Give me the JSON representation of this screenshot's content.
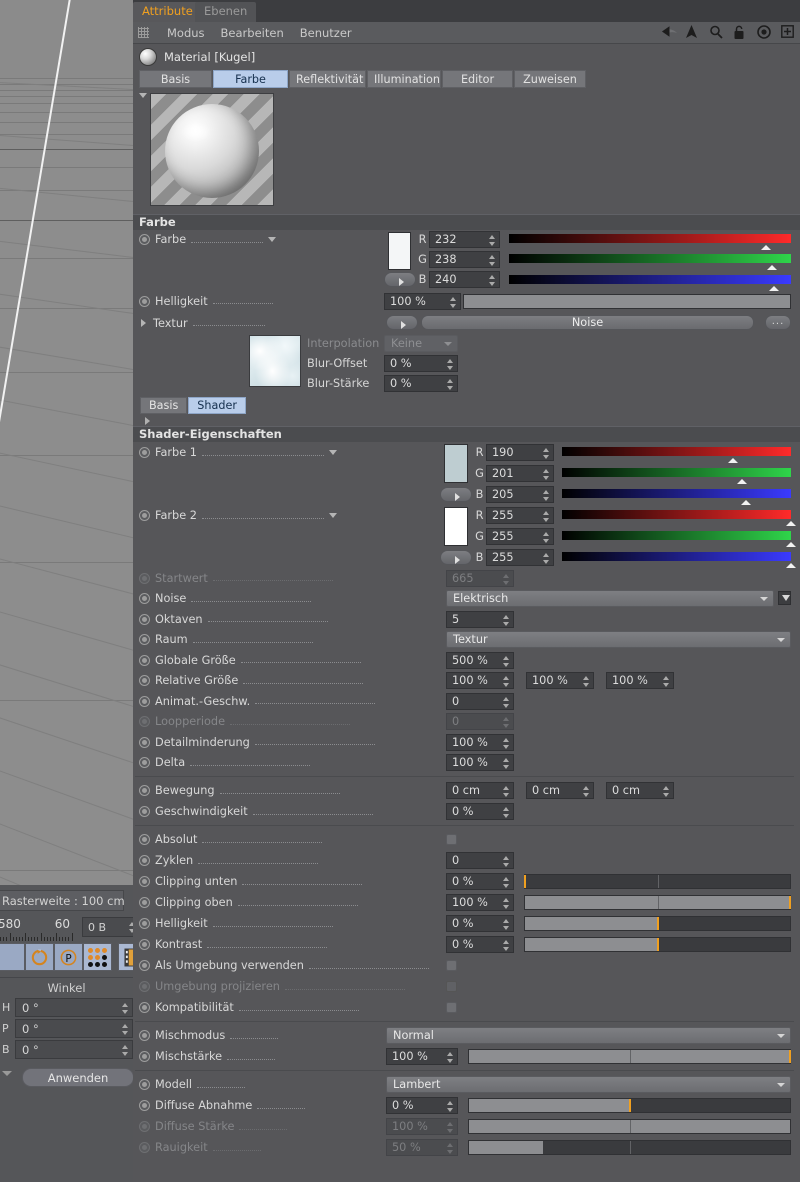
{
  "viewport": {
    "name": "perspective-viewport"
  },
  "left_panel": {
    "raster_label": "Rasterweite : 100 cm",
    "num_left": "580",
    "num_right": "60",
    "ob_value": "0 B",
    "icons": [
      "cycle-icon",
      "parametric-icon",
      "dots-grid-icon",
      "film-strip-icon"
    ],
    "winkel_title": "Winkel",
    "angles": [
      {
        "axis": "H",
        "value": "0 °"
      },
      {
        "axis": "P",
        "value": "0 °"
      },
      {
        "axis": "B",
        "value": "0 °"
      }
    ],
    "apply_label": "Anwenden"
  },
  "window_tabs": [
    {
      "label": "Attribute",
      "active": true
    },
    {
      "label": "Ebenen",
      "active": false
    }
  ],
  "menubar": {
    "items": [
      "Modus",
      "Bearbeiten",
      "Benutzer"
    ],
    "icons": [
      "back-arrow-icon",
      "up-arrow-icon",
      "search-icon",
      "lock-icon",
      "target-icon",
      "plus-box-icon"
    ]
  },
  "material": {
    "title": "Material [Kugel]",
    "tabs": [
      {
        "label": "Basis",
        "active": false
      },
      {
        "label": "Farbe",
        "active": true
      },
      {
        "label": "Reflektivität",
        "active": false
      },
      {
        "label": "Illumination",
        "active": false
      },
      {
        "label": "Editor",
        "active": false
      },
      {
        "label": "Zuweisen",
        "active": false
      }
    ]
  },
  "farbe_section": {
    "header": "Farbe",
    "color": {
      "label": "Farbe",
      "swatch_hex": "#f4f6f7",
      "channels": [
        {
          "name": "R",
          "value": "232",
          "pct": 91
        },
        {
          "name": "G",
          "value": "238",
          "pct": 93.3
        },
        {
          "name": "B",
          "value": "240",
          "pct": 94.1
        }
      ]
    },
    "brightness": {
      "label": "Helligkeit",
      "value": "100 %",
      "pct": 100
    },
    "texture": {
      "label": "Textur",
      "name": "Noise",
      "more_label": "...",
      "interpolation_label": "Interpolation",
      "interpolation_value": "Keine",
      "blur_offset_label": "Blur-Offset",
      "blur_offset_value": "0 %",
      "blur_strength_label": "Blur-Stärke",
      "blur_strength_value": "0 %"
    }
  },
  "shader_tabs": [
    {
      "label": "Basis",
      "active": false
    },
    {
      "label": "Shader",
      "active": true
    }
  ],
  "shader_section": {
    "header": "Shader-Eigenschaften",
    "color1": {
      "label": "Farbe 1",
      "swatch_hex": "#becdd1",
      "channels": [
        {
          "name": "R",
          "value": "190",
          "pct": 74.5
        },
        {
          "name": "G",
          "value": "201",
          "pct": 78.8
        },
        {
          "name": "B",
          "value": "205",
          "pct": 80.4
        }
      ]
    },
    "color2": {
      "label": "Farbe 2",
      "swatch_hex": "#ffffff",
      "channels": [
        {
          "name": "R",
          "value": "255",
          "pct": 100
        },
        {
          "name": "G",
          "value": "255",
          "pct": 100
        },
        {
          "name": "B",
          "value": "255",
          "pct": 100
        }
      ]
    },
    "params": [
      {
        "label": "Startwert",
        "value": "665",
        "type": "number",
        "dim": true
      },
      {
        "label": "Noise",
        "value": "Elektrisch",
        "type": "dropdown-wide",
        "dim": false
      },
      {
        "label": "Oktaven",
        "value": "5",
        "type": "number",
        "dim": false
      },
      {
        "label": "Raum",
        "value": "Textur",
        "type": "dropdown-wide",
        "dim": false
      },
      {
        "label": "Globale Größe",
        "value": "500 %",
        "type": "number",
        "dim": false
      },
      {
        "label": "Relative Größe",
        "value": "100 %",
        "value2": "100 %",
        "value3": "100 %",
        "type": "number3",
        "dim": false
      },
      {
        "label": "Animat.-Geschw.",
        "value": "0",
        "type": "number",
        "dim": false
      },
      {
        "label": "Loopperiode",
        "value": "0",
        "type": "number",
        "dim": true
      },
      {
        "label": "Detailminderung",
        "value": "100 %",
        "type": "number",
        "dim": false
      },
      {
        "label": "Delta",
        "value": "100 %",
        "type": "number",
        "dim": false
      }
    ],
    "motion": [
      {
        "label": "Bewegung",
        "value": "0 cm",
        "value2": "0 cm",
        "value3": "0 cm",
        "type": "number3",
        "dim": false
      },
      {
        "label": "Geschwindigkeit",
        "value": "0 %",
        "type": "number",
        "dim": false
      }
    ],
    "clipping": [
      {
        "label": "Absolut",
        "type": "checkbox",
        "checked": false,
        "dim": false
      },
      {
        "label": "Zyklen",
        "value": "0",
        "type": "number",
        "dim": false
      },
      {
        "label": "Clipping unten",
        "value": "0 %",
        "type": "slider",
        "fill": 0,
        "mark": 0,
        "dim": false
      },
      {
        "label": "Clipping oben",
        "value": "100 %",
        "type": "slider",
        "fill": 100,
        "mark": 100,
        "dim": false
      },
      {
        "label": "Helligkeit",
        "value": "0 %",
        "type": "slider",
        "fill": 50,
        "mark": 50,
        "dim": false
      },
      {
        "label": "Kontrast",
        "value": "0 %",
        "type": "slider",
        "fill": 50,
        "mark": 50,
        "dim": false
      },
      {
        "label": "Als Umgebung verwenden",
        "type": "checkbox",
        "checked": false,
        "dim": false
      },
      {
        "label": "Umgebung projizieren",
        "type": "checkbox",
        "checked": false,
        "dim": true
      },
      {
        "label": "Kompatibilität",
        "type": "checkbox",
        "checked": false,
        "dim": false
      }
    ],
    "mix": [
      {
        "label": "Mischmodus",
        "value": "Normal",
        "type": "dropdown-wide",
        "dim": false
      },
      {
        "label": "Mischstärke",
        "value": "100 %",
        "type": "slider",
        "fill": 100,
        "mark": 100,
        "dim": false
      }
    ],
    "model": [
      {
        "label": "Modell",
        "value": "Lambert",
        "type": "dropdown-wide",
        "dim": false
      },
      {
        "label": "Diffuse Abnahme",
        "value": "0 %",
        "type": "slider",
        "fill": 50,
        "mark": 50,
        "dim": false
      },
      {
        "label": "Diffuse Stärke",
        "value": "100 %",
        "type": "slider",
        "fill": 100,
        "mark": -1,
        "dim": true
      },
      {
        "label": "Rauigkeit",
        "value": "50 %",
        "type": "slider",
        "fill": 23,
        "mark": -1,
        "dim": true
      }
    ]
  },
  "colors": {
    "accent": "#f0a020",
    "tab_active": "#b9cdea",
    "panel_bg": "#565659",
    "field_bg": "#3f4043"
  }
}
